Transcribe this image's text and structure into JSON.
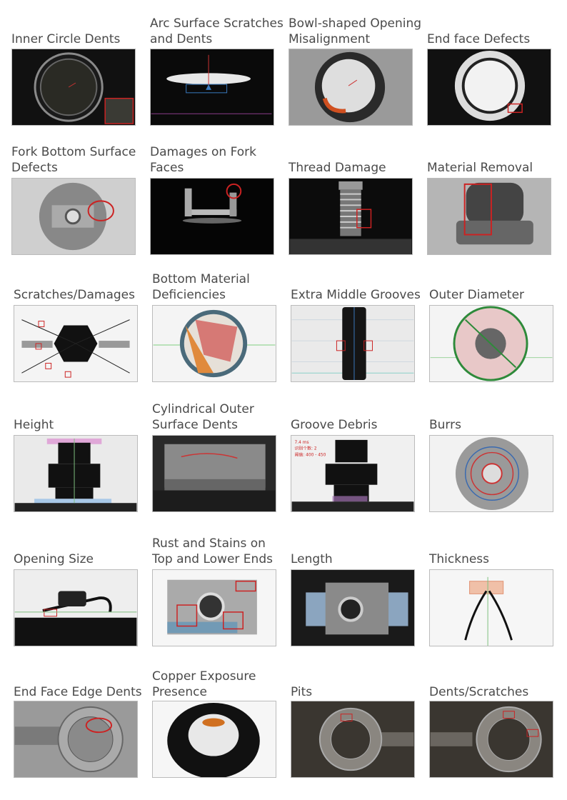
{
  "items": [
    {
      "label": "Inner Circle Dents",
      "kind": "ring-dark"
    },
    {
      "label": "Arc Surface Scratches\nand Dents",
      "kind": "arc-surface"
    },
    {
      "label": "Bowl-shaped Opening\nMisalignment",
      "kind": "bowl"
    },
    {
      "label": "End face Defects",
      "kind": "end-face"
    },
    {
      "label": "Fork Bottom Surface\nDefects",
      "kind": "fork-bottom"
    },
    {
      "label": "Damages on Fork\nFaces",
      "kind": "fork-face"
    },
    {
      "label": "Thread Damage",
      "kind": "thread"
    },
    {
      "label": "Material Removal",
      "kind": "material-removal"
    },
    {
      "label": "Scratches/Damages",
      "kind": "star"
    },
    {
      "label": "Bottom Material\nDeficiencies",
      "kind": "bottom-material"
    },
    {
      "label": "Extra Middle Grooves",
      "kind": "middle-grooves"
    },
    {
      "label": "Outer Diameter",
      "kind": "outer-diameter"
    },
    {
      "label": "Height",
      "kind": "height"
    },
    {
      "label": "Cylindrical Outer\nSurface Dents",
      "kind": "cyl-dents"
    },
    {
      "label": "Groove Debris",
      "kind": "groove-debris"
    },
    {
      "label": "Burrs",
      "kind": "burrs"
    },
    {
      "label": "Opening Size",
      "kind": "opening-size"
    },
    {
      "label": "Rust and Stains on\nTop and Lower Ends",
      "kind": "rust"
    },
    {
      "label": "Length",
      "kind": "length"
    },
    {
      "label": "Thickness",
      "kind": "thickness"
    },
    {
      "label": "End Face Edge Dents",
      "kind": "edge-dents"
    },
    {
      "label": "Copper Exposure\nPresence",
      "kind": "copper"
    },
    {
      "label": "Pits",
      "kind": "pits"
    },
    {
      "label": "Dents/Scratches",
      "kind": "dents-scratches"
    }
  ],
  "groove_debris_overlay": [
    "7.4 ms",
    "识别个数: 2",
    "阈值: 400 - 450"
  ]
}
